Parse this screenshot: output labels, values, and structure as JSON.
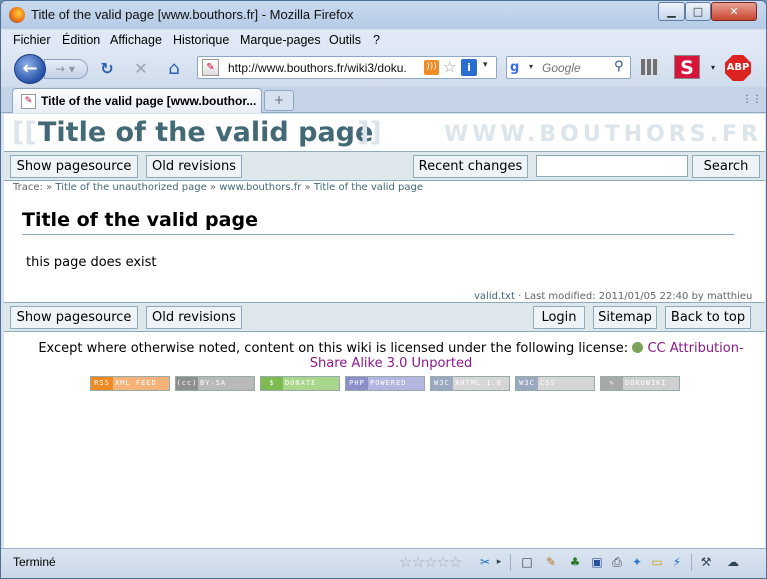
{
  "window": {
    "title": "Title of the valid page [www.bouthors.fr] - Mozilla Firefox",
    "min_glyph": "▁",
    "max_glyph": "□",
    "close_glyph": "✕"
  },
  "menu": {
    "items": [
      "Fichier",
      "Édition",
      "Affichage",
      "Historique",
      "Marque-pages",
      "Outils",
      "?"
    ]
  },
  "nav": {
    "back_glyph": "←",
    "forward_glyph": "→ ▾",
    "reload_glyph": "↻",
    "stop_glyph": "✕",
    "home_glyph": "⌂",
    "url": "http://www.bouthors.fr/wiki3/doku.",
    "site_icon_glyph": "✎",
    "rss_glyph": ")))",
    "star_glyph": "☆",
    "info_glyph": "i",
    "url_dropdown_glyph": "▾",
    "search_engine_glyph": "g",
    "search_engine_drop": "▾",
    "search_placeholder": "Google",
    "search_glyph": "⚲",
    "s_icon": "S",
    "s_drop": "▾",
    "abp_icon": "ABP"
  },
  "tabs": {
    "items": [
      {
        "title": "Title of the valid page [www.bouthor..."
      }
    ],
    "new_tab_glyph": "+",
    "tab_list_glyph": "⋮⋮"
  },
  "page": {
    "bracket_open": "[[",
    "bracket_close": "]]",
    "title": "Title of the valid page",
    "site_name": "WWW.BOUTHORS.FR",
    "top_bar": {
      "show_source": "Show pagesource",
      "old_revisions": "Old revisions",
      "recent_changes": "Recent changes",
      "search_value": "",
      "search_button": "Search"
    },
    "trace": {
      "label": "Trace:",
      "items": [
        "Title of the unauthorized page",
        "www.bouthors.fr",
        "Title of the valid page"
      ],
      "separator": "»"
    },
    "heading": "Title of the valid page",
    "body_text": "this page does exist",
    "meta": {
      "file": "valid.txt",
      "text": " · Last modified: 2011/01/05 22:40 by matthieu"
    },
    "bottom_bar": {
      "show_source": "Show pagesource",
      "old_revisions": "Old revisions",
      "login": "Login",
      "sitemap": "Sitemap",
      "back_to_top": "Back to top"
    },
    "license": {
      "prefix": "Except where otherwise noted, content on this wiki is licensed under the following license:",
      "link_text": "CC Attribution-Share Alike 3.0 Unported"
    },
    "badges": [
      {
        "label": "RSS",
        "text": "XML FEED",
        "color": "#f08a24"
      },
      {
        "label": "(cc)",
        "text": "BY-SA",
        "color": "#8f8f8f"
      },
      {
        "label": "$",
        "text": "DONATE",
        "color": "#7dbb50"
      },
      {
        "label": "PHP",
        "text": "POWERED",
        "color": "#8a8fc9"
      },
      {
        "label": "W3C",
        "text": "XHTML 1.0",
        "color": "#b5b5b5"
      },
      {
        "label": "W3C",
        "text": "CSS",
        "color": "#b5b5b5"
      },
      {
        "label": "✎",
        "text": "DOKUWIKI",
        "color": "#a8a8a8"
      }
    ]
  },
  "status": {
    "text": "Terminé",
    "stars": "☆☆☆☆☆",
    "icons": [
      "✂",
      "▸",
      "□",
      "✎",
      "♣",
      "▣",
      "⎙",
      "✦",
      "▭",
      "⚡",
      "⚒",
      "☁"
    ]
  },
  "colors": {
    "accent": "#436976",
    "bar_bg": "#dee7ec",
    "bar_border": "#8cacbb",
    "license_link": "#8a1a8a"
  }
}
